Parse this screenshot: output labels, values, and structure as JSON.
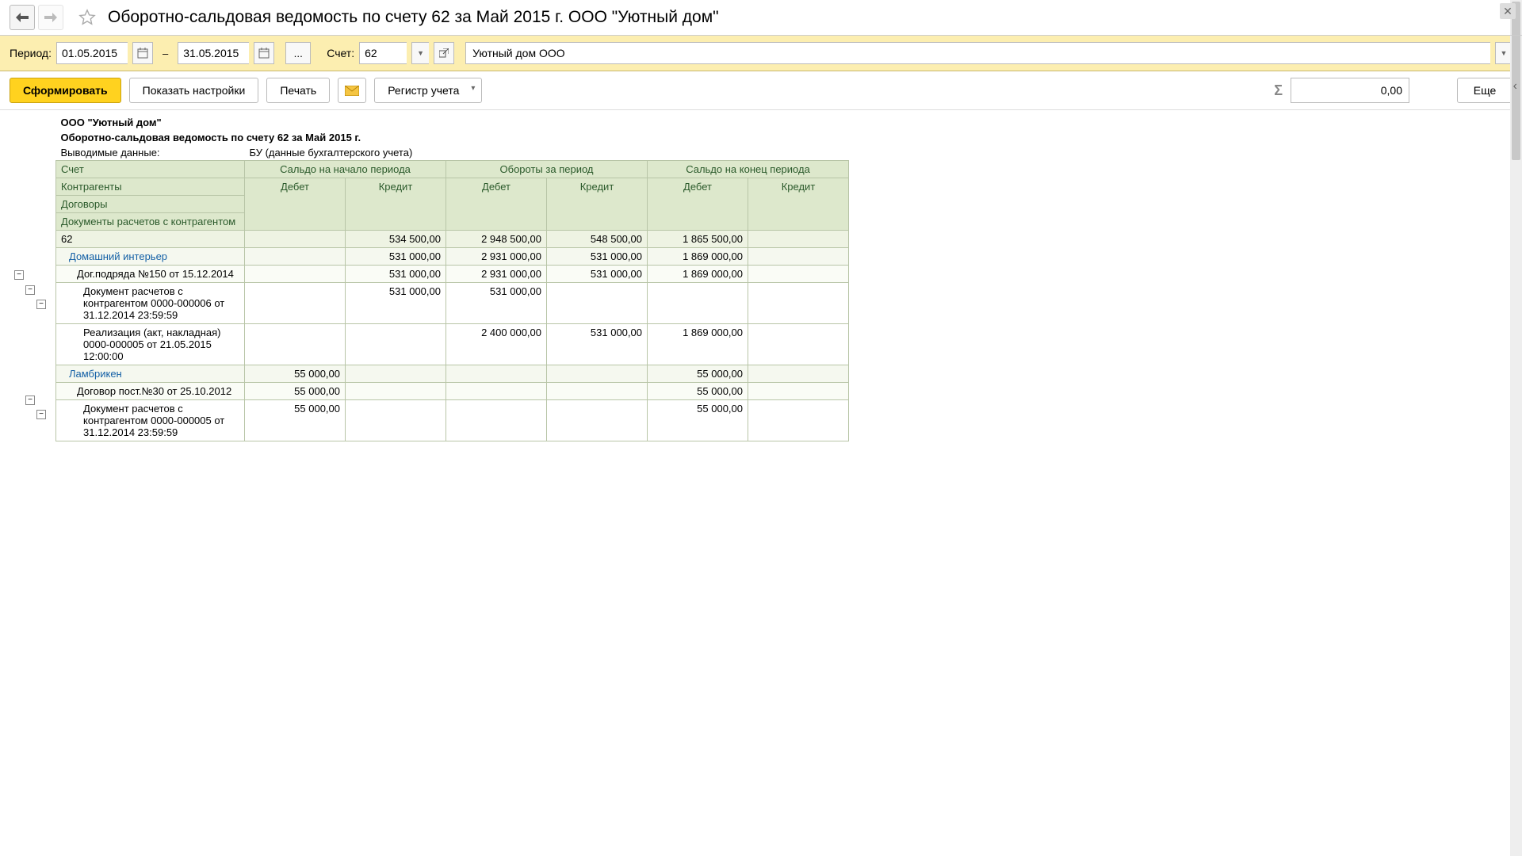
{
  "header": {
    "title": "Оборотно-сальдовая ведомость по счету 62 за Май 2015 г. ООО \"Уютный дом\""
  },
  "filter": {
    "period_label": "Период:",
    "date_from": "01.05.2015",
    "date_to": "31.05.2015",
    "dash": "–",
    "ellipsis": "...",
    "account_label": "Счет:",
    "account": "62",
    "org": "Уютный дом ООО"
  },
  "actions": {
    "generate": "Сформировать",
    "show_settings": "Показать настройки",
    "print": "Печать",
    "register": "Регистр учета",
    "sum_value": "0,00",
    "more": "Еще"
  },
  "report": {
    "org": "ООО \"Уютный дом\"",
    "title": "Оборотно-сальдовая ведомость по счету 62 за Май 2015 г.",
    "meta_label": "Выводимые данные:",
    "meta_value": "БУ (данные бухгалтерского учета)",
    "col_group_left": [
      "Счет",
      "Контрагенты",
      "Договоры",
      "Документы расчетов с контрагентом"
    ],
    "groups": {
      "start": "Сальдо на начало периода",
      "turn": "Обороты за период",
      "end": "Сальдо на конец периода"
    },
    "sub": {
      "debit": "Дебет",
      "credit": "Кредит"
    },
    "rows": [
      {
        "level": 0,
        "label": "62",
        "start_d": "",
        "start_c": "534 500,00",
        "turn_d": "2 948 500,00",
        "turn_c": "548 500,00",
        "end_d": "1 865 500,00",
        "end_c": ""
      },
      {
        "level": 1,
        "label": "Домашний интерьер",
        "link": true,
        "start_d": "",
        "start_c": "531 000,00",
        "turn_d": "2 931 000,00",
        "turn_c": "531 000,00",
        "end_d": "1 869 000,00",
        "end_c": ""
      },
      {
        "level": 2,
        "label": "Дог.подряда №150 от 15.12.2014",
        "start_d": "",
        "start_c": "531 000,00",
        "turn_d": "2 931 000,00",
        "turn_c": "531 000,00",
        "end_d": "1 869 000,00",
        "end_c": ""
      },
      {
        "level": 3,
        "label": "Документ расчетов с контрагентом 0000-000006 от 31.12.2014 23:59:59",
        "start_d": "",
        "start_c": "531 000,00",
        "turn_d": "531 000,00",
        "turn_c": "",
        "end_d": "",
        "end_c": ""
      },
      {
        "level": 3,
        "label": "Реализация (акт, накладная) 0000-000005 от 21.05.2015 12:00:00",
        "start_d": "",
        "start_c": "",
        "turn_d": "2 400 000,00",
        "turn_c": "531 000,00",
        "end_d": "1 869 000,00",
        "end_c": ""
      },
      {
        "level": 1,
        "label": "Ламбрикен",
        "link": true,
        "start_d": "55 000,00",
        "start_c": "",
        "turn_d": "",
        "turn_c": "",
        "end_d": "55 000,00",
        "end_c": ""
      },
      {
        "level": 2,
        "label": "Договор пост.№30 от 25.10.2012",
        "start_d": "55 000,00",
        "start_c": "",
        "turn_d": "",
        "turn_c": "",
        "end_d": "55 000,00",
        "end_c": ""
      },
      {
        "level": 3,
        "label": "Документ расчетов с контрагентом 0000-000005 от 31.12.2014 23:59:59",
        "start_d": "55 000,00",
        "start_c": "",
        "turn_d": "",
        "turn_c": "",
        "end_d": "55 000,00",
        "end_c": ""
      }
    ]
  }
}
